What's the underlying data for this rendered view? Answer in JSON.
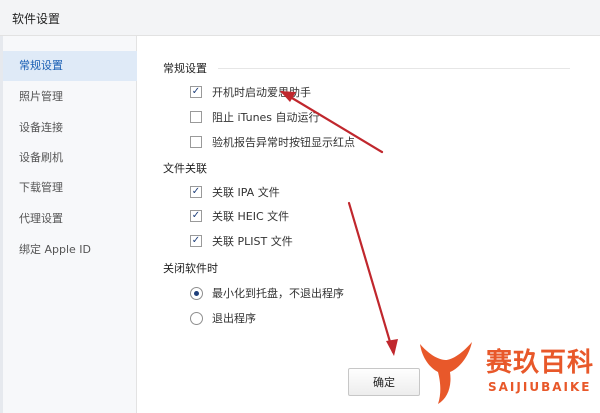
{
  "window": {
    "title": "软件设置"
  },
  "sidebar": {
    "items": [
      {
        "label": "常规设置",
        "active": true
      },
      {
        "label": "照片管理",
        "active": false
      },
      {
        "label": "设备连接",
        "active": false
      },
      {
        "label": "设备刷机",
        "active": false
      },
      {
        "label": "下载管理",
        "active": false
      },
      {
        "label": "代理设置",
        "active": false
      },
      {
        "label": "绑定 Apple ID",
        "active": false
      }
    ]
  },
  "general": {
    "title": "常规设置",
    "options": [
      {
        "label": "开机时启动爱思助手",
        "checked": true
      },
      {
        "label": "阻止 iTunes 自动运行",
        "checked": false
      },
      {
        "label": "验机报告异常时按钮显示红点",
        "checked": false
      }
    ]
  },
  "file_assoc": {
    "title": "文件关联",
    "options": [
      {
        "label": "关联 IPA 文件",
        "checked": true
      },
      {
        "label": "关联 HEIC 文件",
        "checked": true
      },
      {
        "label": "关联 PLIST 文件",
        "checked": true
      }
    ]
  },
  "close_behavior": {
    "title": "关闭软件时",
    "options": [
      {
        "label": "最小化到托盘，不退出程序",
        "selected": true
      },
      {
        "label": "退出程序",
        "selected": false
      }
    ]
  },
  "footer": {
    "confirm_label": "确定"
  },
  "watermark": {
    "cn": "赛玖百科",
    "en": "SAIJIUBAIKE"
  },
  "colors": {
    "accent": "#1a5fb4",
    "annotation_arrow": "#c0272d",
    "watermark": "#e8582a"
  },
  "icons": {
    "checkmark": "check-icon",
    "radio": "radio-dot-icon",
    "logo": "whale-tail-logo"
  }
}
